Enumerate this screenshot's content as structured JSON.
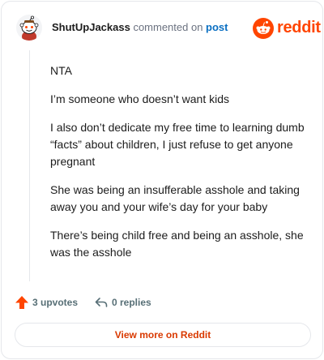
{
  "header": {
    "username": "ShutUpJackass",
    "verb": " commented on ",
    "post_link": "post"
  },
  "brand": {
    "wordmark": "reddit",
    "accent_color": "#ff4500"
  },
  "comment": {
    "paragraphs": [
      "NTA",
      "I’m someone who doesn’t want kids",
      "I also don’t dedicate my free time to learning dumb “facts” about children, I just refuse to get anyone pregnant",
      "She was being an insufferable asshole and taking away you and your wife’s day for your baby",
      "There’s being child free and being an asshole, she was the asshole"
    ]
  },
  "actions": {
    "upvotes": "3 upvotes",
    "replies": "0 replies"
  },
  "footer": {
    "view_more": "View more on Reddit"
  },
  "icons": {
    "avatar": "snoo-avatar-icon",
    "brand": "reddit-logo-icon",
    "upvote": "upvote-arrow-icon",
    "reply": "reply-arrow-icon"
  }
}
